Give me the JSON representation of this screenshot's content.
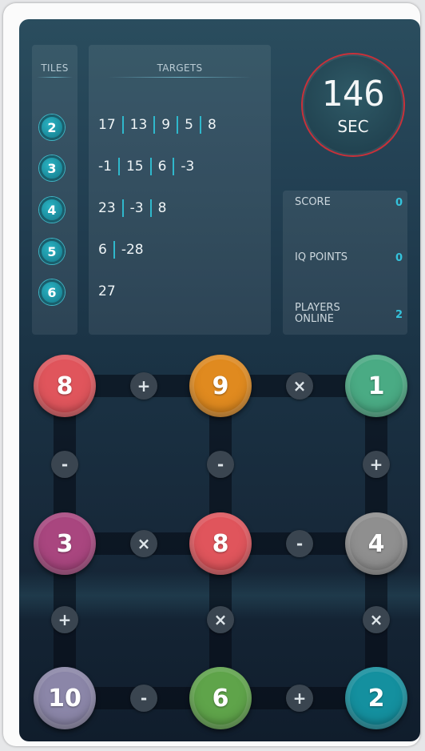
{
  "headers": {
    "tiles": "TILES",
    "targets": "TARGETS"
  },
  "tiles": [
    "2",
    "3",
    "4",
    "5",
    "6"
  ],
  "targets": [
    [
      "17",
      "13",
      "9",
      "5",
      "8"
    ],
    [
      "-1",
      "15",
      "6",
      "-3"
    ],
    [
      "23",
      "-3",
      "8"
    ],
    [
      "6",
      "-28"
    ],
    [
      "27"
    ]
  ],
  "timer": {
    "value": "146",
    "unit": "SEC"
  },
  "stats": {
    "score_label": "SCORE",
    "score_value": "0",
    "iq_label": "IQ POINTS",
    "iq_value": "0",
    "players_label_1": "PLAYERS",
    "players_label_2": "ONLINE",
    "players_value": "2"
  },
  "grid": {
    "balls": [
      {
        "value": "8",
        "color": "#e0555c"
      },
      {
        "value": "9",
        "color": "#e08a1f"
      },
      {
        "value": "1",
        "color": "#4aab84"
      },
      {
        "value": "3",
        "color": "#a9467f"
      },
      {
        "value": "8",
        "color": "#e0555c"
      },
      {
        "value": "4",
        "color": "#8f8f8f"
      },
      {
        "value": "10",
        "color": "#8b86a8"
      },
      {
        "value": "6",
        "color": "#5fa44a"
      },
      {
        "value": "2",
        "color": "#14909f"
      }
    ],
    "ops": {
      "h": [
        "+",
        "×",
        "×",
        "-",
        "-",
        "+"
      ],
      "v": [
        "-",
        "-",
        "+",
        "+",
        "×",
        "×"
      ]
    }
  }
}
